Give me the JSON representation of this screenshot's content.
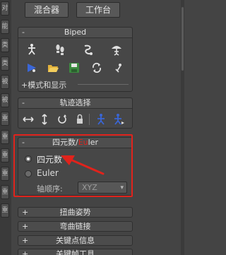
{
  "top_buttons": {
    "mixer": "混合器",
    "workbench": "工作台"
  },
  "left_strip": [
    "对",
    "能",
    "类",
    "类",
    "被",
    "被",
    "重",
    "重",
    "重",
    "重",
    "重",
    "重"
  ],
  "biped": {
    "title": "Biped",
    "collapse_sign": "-",
    "icons_row1": [
      "figure-mode-icon",
      "footstep-mode-icon",
      "motion-flow-icon",
      "mixer-mode-icon"
    ],
    "icons_row2": [
      "play-biped-icon",
      "load-file-icon",
      "save-file-icon",
      "convert-icon",
      "move-all-icon"
    ],
    "mode_display": "+模式和显示"
  },
  "track_selection": {
    "title": "轨迹选择",
    "collapse_sign": "-",
    "icons": [
      "body-horizontal-icon",
      "body-vertical-icon",
      "body-rotation-icon",
      "lock-cob-icon",
      "symmetrical-icon",
      "opposite-icon"
    ]
  },
  "quaternion_euler": {
    "title_prefix": "四元数/",
    "title_mid": "Eu",
    "title_suffix": "ler",
    "collapse_sign": "-",
    "option_quaternion": "四元数",
    "option_euler": "Euler",
    "axis_order_label": "轴顺序:",
    "axis_order_value": "XYZ",
    "selected": "quaternion"
  },
  "collapsed_rollouts": [
    {
      "sign": "+",
      "label": "扭曲姿势"
    },
    {
      "sign": "+",
      "label": "弯曲链接"
    },
    {
      "sign": "+",
      "label": "关键点信息"
    },
    {
      "sign": "+",
      "label": "关键帧工具"
    }
  ],
  "colors": {
    "annotation_red": "#e0231c",
    "panel_bg": "#444444"
  }
}
